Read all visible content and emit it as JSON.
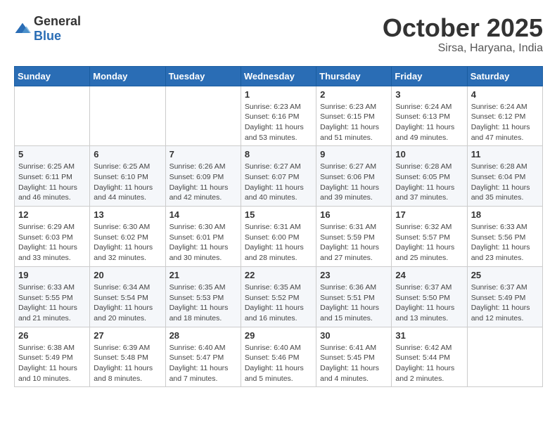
{
  "header": {
    "logo": {
      "general": "General",
      "blue": "Blue"
    },
    "month": "October 2025",
    "location": "Sirsa, Haryana, India"
  },
  "days_of_week": [
    "Sunday",
    "Monday",
    "Tuesday",
    "Wednesday",
    "Thursday",
    "Friday",
    "Saturday"
  ],
  "weeks": [
    [
      {
        "day": "",
        "info": ""
      },
      {
        "day": "",
        "info": ""
      },
      {
        "day": "",
        "info": ""
      },
      {
        "day": "1",
        "info": "Sunrise: 6:23 AM\nSunset: 6:16 PM\nDaylight: 11 hours\nand 53 minutes."
      },
      {
        "day": "2",
        "info": "Sunrise: 6:23 AM\nSunset: 6:15 PM\nDaylight: 11 hours\nand 51 minutes."
      },
      {
        "day": "3",
        "info": "Sunrise: 6:24 AM\nSunset: 6:13 PM\nDaylight: 11 hours\nand 49 minutes."
      },
      {
        "day": "4",
        "info": "Sunrise: 6:24 AM\nSunset: 6:12 PM\nDaylight: 11 hours\nand 47 minutes."
      }
    ],
    [
      {
        "day": "5",
        "info": "Sunrise: 6:25 AM\nSunset: 6:11 PM\nDaylight: 11 hours\nand 46 minutes."
      },
      {
        "day": "6",
        "info": "Sunrise: 6:25 AM\nSunset: 6:10 PM\nDaylight: 11 hours\nand 44 minutes."
      },
      {
        "day": "7",
        "info": "Sunrise: 6:26 AM\nSunset: 6:09 PM\nDaylight: 11 hours\nand 42 minutes."
      },
      {
        "day": "8",
        "info": "Sunrise: 6:27 AM\nSunset: 6:07 PM\nDaylight: 11 hours\nand 40 minutes."
      },
      {
        "day": "9",
        "info": "Sunrise: 6:27 AM\nSunset: 6:06 PM\nDaylight: 11 hours\nand 39 minutes."
      },
      {
        "day": "10",
        "info": "Sunrise: 6:28 AM\nSunset: 6:05 PM\nDaylight: 11 hours\nand 37 minutes."
      },
      {
        "day": "11",
        "info": "Sunrise: 6:28 AM\nSunset: 6:04 PM\nDaylight: 11 hours\nand 35 minutes."
      }
    ],
    [
      {
        "day": "12",
        "info": "Sunrise: 6:29 AM\nSunset: 6:03 PM\nDaylight: 11 hours\nand 33 minutes."
      },
      {
        "day": "13",
        "info": "Sunrise: 6:30 AM\nSunset: 6:02 PM\nDaylight: 11 hours\nand 32 minutes."
      },
      {
        "day": "14",
        "info": "Sunrise: 6:30 AM\nSunset: 6:01 PM\nDaylight: 11 hours\nand 30 minutes."
      },
      {
        "day": "15",
        "info": "Sunrise: 6:31 AM\nSunset: 6:00 PM\nDaylight: 11 hours\nand 28 minutes."
      },
      {
        "day": "16",
        "info": "Sunrise: 6:31 AM\nSunset: 5:59 PM\nDaylight: 11 hours\nand 27 minutes."
      },
      {
        "day": "17",
        "info": "Sunrise: 6:32 AM\nSunset: 5:57 PM\nDaylight: 11 hours\nand 25 minutes."
      },
      {
        "day": "18",
        "info": "Sunrise: 6:33 AM\nSunset: 5:56 PM\nDaylight: 11 hours\nand 23 minutes."
      }
    ],
    [
      {
        "day": "19",
        "info": "Sunrise: 6:33 AM\nSunset: 5:55 PM\nDaylight: 11 hours\nand 21 minutes."
      },
      {
        "day": "20",
        "info": "Sunrise: 6:34 AM\nSunset: 5:54 PM\nDaylight: 11 hours\nand 20 minutes."
      },
      {
        "day": "21",
        "info": "Sunrise: 6:35 AM\nSunset: 5:53 PM\nDaylight: 11 hours\nand 18 minutes."
      },
      {
        "day": "22",
        "info": "Sunrise: 6:35 AM\nSunset: 5:52 PM\nDaylight: 11 hours\nand 16 minutes."
      },
      {
        "day": "23",
        "info": "Sunrise: 6:36 AM\nSunset: 5:51 PM\nDaylight: 11 hours\nand 15 minutes."
      },
      {
        "day": "24",
        "info": "Sunrise: 6:37 AM\nSunset: 5:50 PM\nDaylight: 11 hours\nand 13 minutes."
      },
      {
        "day": "25",
        "info": "Sunrise: 6:37 AM\nSunset: 5:49 PM\nDaylight: 11 hours\nand 12 minutes."
      }
    ],
    [
      {
        "day": "26",
        "info": "Sunrise: 6:38 AM\nSunset: 5:49 PM\nDaylight: 11 hours\nand 10 minutes."
      },
      {
        "day": "27",
        "info": "Sunrise: 6:39 AM\nSunset: 5:48 PM\nDaylight: 11 hours\nand 8 minutes."
      },
      {
        "day": "28",
        "info": "Sunrise: 6:40 AM\nSunset: 5:47 PM\nDaylight: 11 hours\nand 7 minutes."
      },
      {
        "day": "29",
        "info": "Sunrise: 6:40 AM\nSunset: 5:46 PM\nDaylight: 11 hours\nand 5 minutes."
      },
      {
        "day": "30",
        "info": "Sunrise: 6:41 AM\nSunset: 5:45 PM\nDaylight: 11 hours\nand 4 minutes."
      },
      {
        "day": "31",
        "info": "Sunrise: 6:42 AM\nSunset: 5:44 PM\nDaylight: 11 hours\nand 2 minutes."
      },
      {
        "day": "",
        "info": ""
      }
    ]
  ]
}
